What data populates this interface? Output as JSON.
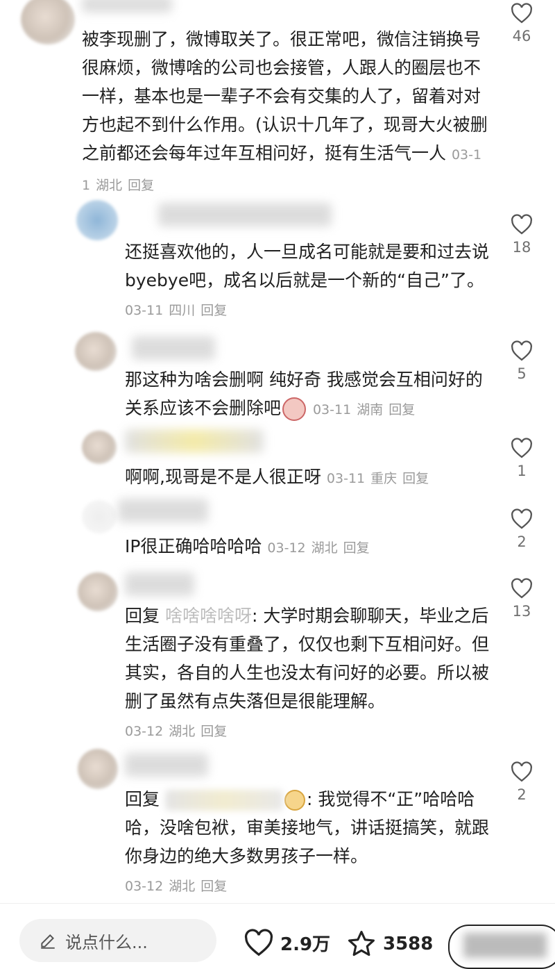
{
  "comments": [
    {
      "text": "被李现删了，微博取关了。很正常吧，微信注销换号很麻烦，微博啥的公司也会接管，人跟人的圈层也不一样，基本也是一辈子不会有交集的人了，留着对对方也起不到什么作用。(认识十几年了，现哥大火被删之前都还会每年过年互相问好，挺有生活气一人",
      "date": "03-11",
      "location": "湖北",
      "reply_label": "回复",
      "likes": "46"
    },
    {
      "text": "还挺喜欢他的，人一旦成名可能就是要和过去说byebye吧，成名以后就是一个新的“自己”了。",
      "date": "03-11",
      "location": "四川",
      "reply_label": "回复",
      "likes": "18"
    },
    {
      "text": "那这种为啥会删啊 纯好奇 我感觉会互相问好的关系应该不会删除吧",
      "date": "03-11",
      "location": "湖南",
      "reply_label": "回复",
      "likes": "5"
    },
    {
      "text": "啊啊,现哥是不是人很正呀",
      "date": "03-11",
      "location": "重庆",
      "reply_label": "回复",
      "likes": "1"
    },
    {
      "text": "IP很正确哈哈哈哈",
      "date": "03-12",
      "location": "湖北",
      "reply_label": "回复",
      "likes": "2"
    },
    {
      "prefix": "回复",
      "reply_to": "啥啥啥啥呀",
      "text": ": 大学时期会聊聊天，毕业之后生活圈子没有重叠了，仅仅也剩下互相问好。但其实，各自的人生也没太有问好的必要。所以被删了虽然有点失落但是很能理解。",
      "date": "03-12",
      "location": "湖北",
      "reply_label": "回复",
      "likes": "13"
    },
    {
      "prefix": "回复",
      "text": ": 我觉得不“正”哈哈哈哈，没啥包袱，审美接地气，讲话挺搞笑，就跟你身边的绝大多数男孩子一样。",
      "date": "03-12",
      "location": "湖北",
      "reply_label": "回复",
      "likes": "2"
    }
  ],
  "bottom_bar": {
    "input_placeholder": "说点什么...",
    "like_count": "2.9万",
    "favorite_count": "3588"
  },
  "icons": {
    "like": "heart-outline-icon",
    "favorite": "star-outline-icon",
    "edit": "pencil-icon"
  }
}
